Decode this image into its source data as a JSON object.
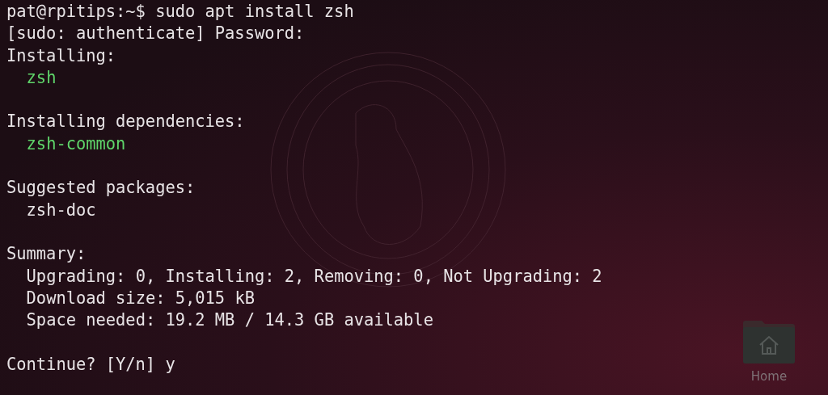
{
  "terminal": {
    "sections": [
      {
        "lines": [
          {
            "text": "pat@rpitips:~$ sudo apt install zsh",
            "indented": false,
            "highlighted": false
          },
          {
            "text": "[sudo: authenticate] Password:",
            "indented": false,
            "highlighted": false
          },
          {
            "text": "Installing:",
            "indented": false,
            "highlighted": false
          },
          {
            "text": "zsh",
            "indented": true,
            "highlighted": true
          }
        ]
      },
      {
        "lines": [
          {
            "text": "Installing dependencies:",
            "indented": false,
            "highlighted": false
          },
          {
            "text": "zsh-common",
            "indented": true,
            "highlighted": true
          }
        ]
      },
      {
        "lines": [
          {
            "text": "Suggested packages:",
            "indented": false,
            "highlighted": false
          },
          {
            "text": "zsh-doc",
            "indented": true,
            "highlighted": false
          }
        ]
      },
      {
        "lines": [
          {
            "text": "Summary:",
            "indented": false,
            "highlighted": false
          },
          {
            "text": "Upgrading: 0, Installing: 2, Removing: 0, Not Upgrading: 2",
            "indented": true,
            "highlighted": false
          },
          {
            "text": "Download size: 5,015 kB",
            "indented": true,
            "highlighted": false
          },
          {
            "text": "Space needed: 19.2 MB / 14.3 GB available",
            "indented": true,
            "highlighted": false
          }
        ]
      },
      {
        "lines": [
          {
            "text": "Continue? [Y/n] y",
            "indented": false,
            "highlighted": false
          }
        ]
      }
    ]
  },
  "desktop_icons": [
    {
      "label": "Home"
    }
  ]
}
